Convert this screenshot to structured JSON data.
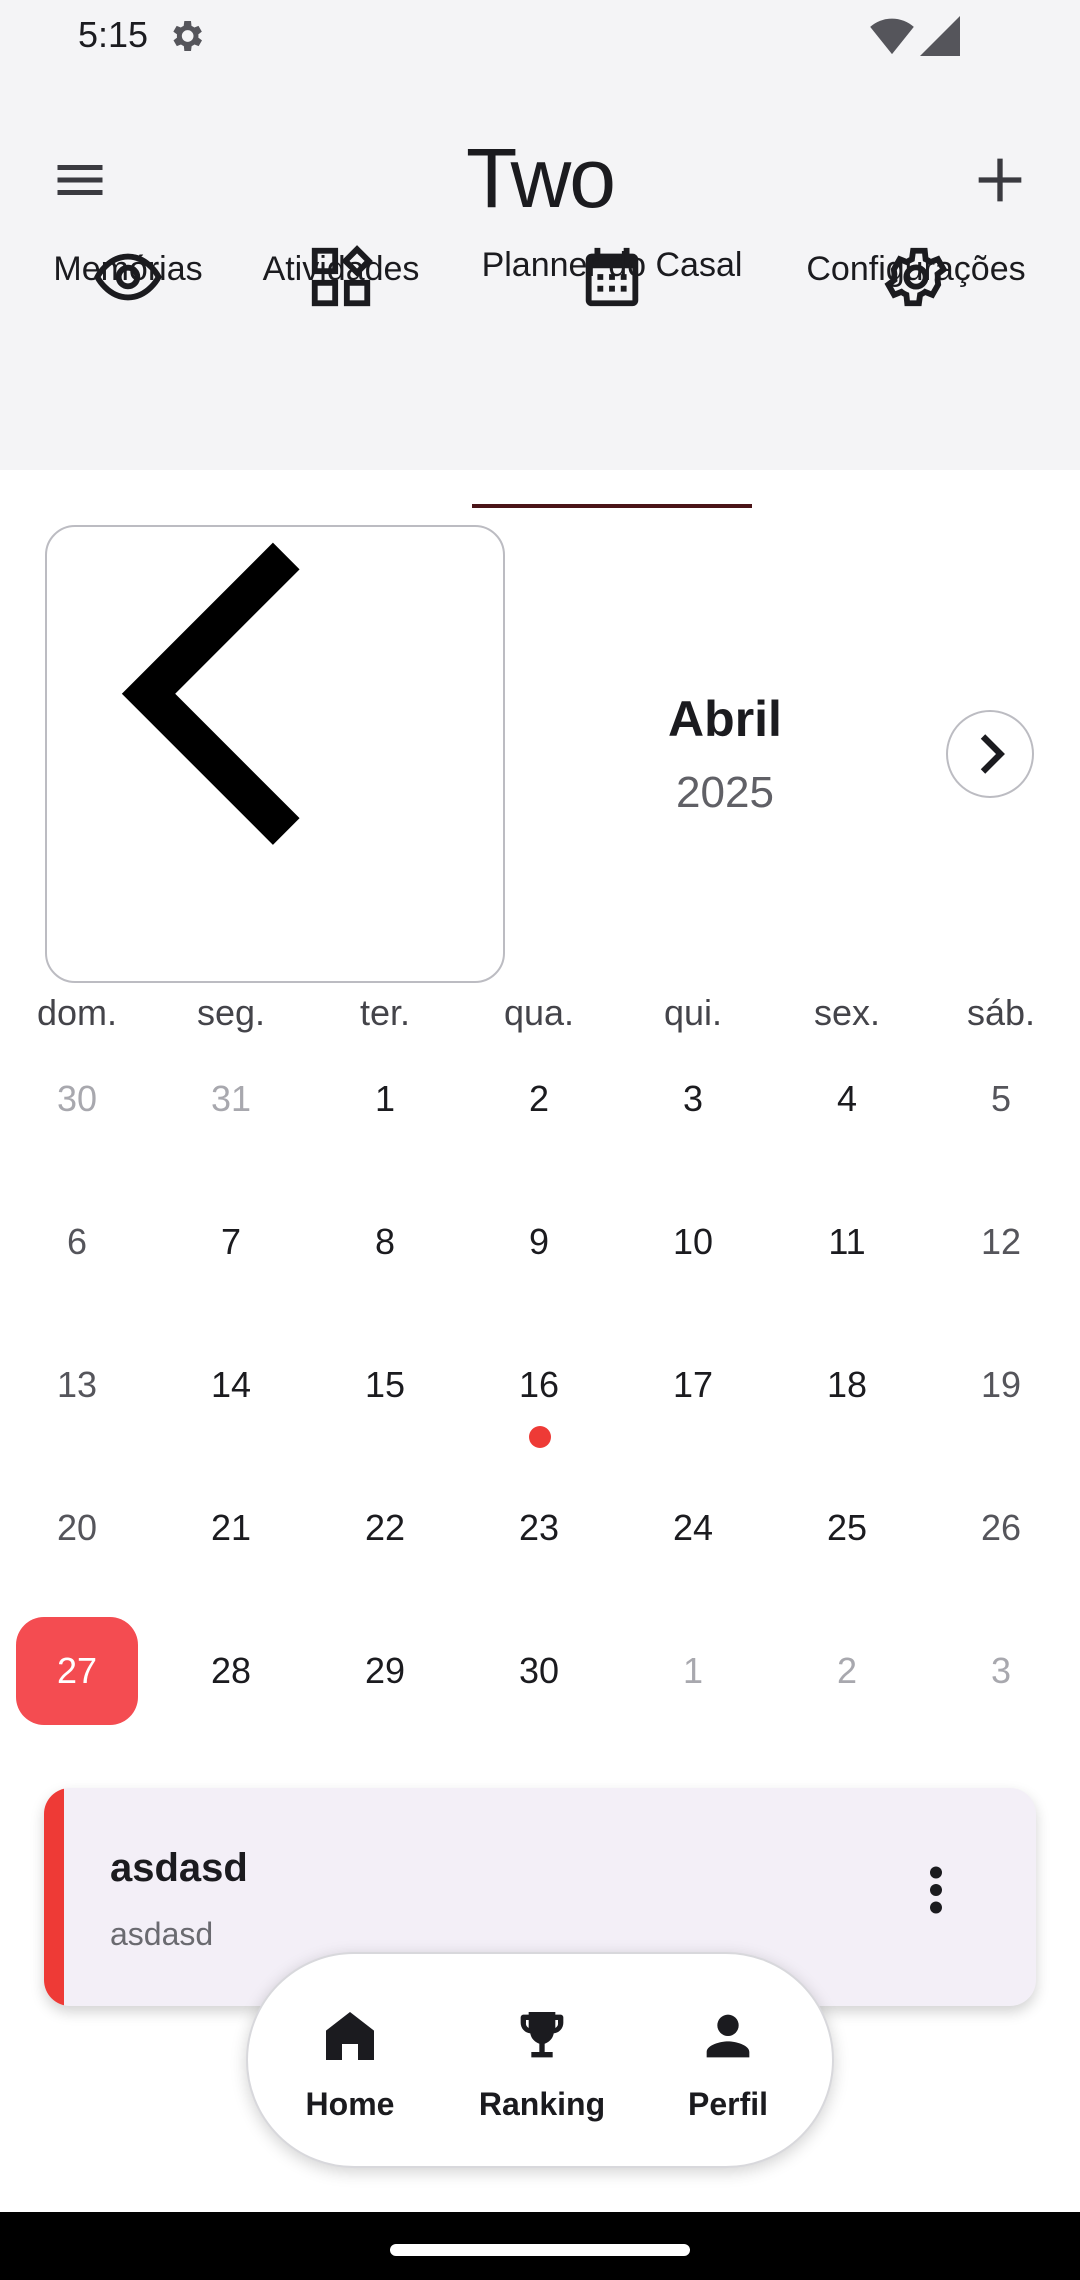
{
  "status_bar": {
    "time": "5:15",
    "icons": [
      "settings-icon",
      "wifi-icon",
      "signal-icon"
    ]
  },
  "app": {
    "title": "Two"
  },
  "tabs": [
    {
      "label": "Memórias",
      "icon": "eye-icon"
    },
    {
      "label": "Atividades",
      "icon": "widgets-icon"
    },
    {
      "label": "Planner do Casal",
      "icon": "calendar-icon",
      "selected": true
    },
    {
      "label": "Configurações",
      "icon": "gear-icon"
    }
  ],
  "calendar": {
    "month": "Abril",
    "year": "2025",
    "weekdays": [
      "dom.",
      "seg.",
      "ter.",
      "qua.",
      "qui.",
      "sex.",
      "sáb."
    ],
    "weeks": [
      [
        "30",
        "31",
        "1",
        "2",
        "3",
        "4",
        "5"
      ],
      [
        "6",
        "7",
        "8",
        "9",
        "10",
        "11",
        "12"
      ],
      [
        "13",
        "14",
        "15",
        "16",
        "17",
        "18",
        "19"
      ],
      [
        "20",
        "21",
        "22",
        "23",
        "24",
        "25",
        "26"
      ],
      [
        "27",
        "28",
        "29",
        "30",
        "1",
        "2",
        "3"
      ]
    ],
    "today": "27",
    "event_day": "16"
  },
  "event": {
    "title": "asdasd",
    "description": "asdasd"
  },
  "bottom_nav": [
    {
      "label": "Home",
      "icon": "home-icon"
    },
    {
      "label": "Ranking",
      "icon": "trophy-icon"
    },
    {
      "label": "Perfil",
      "icon": "person-icon"
    }
  ],
  "colors": {
    "accent": "#f44c51",
    "event": "#ee3a36",
    "tab_indicator": "#4a1418",
    "topbar_bg": "#f4f4f6"
  }
}
